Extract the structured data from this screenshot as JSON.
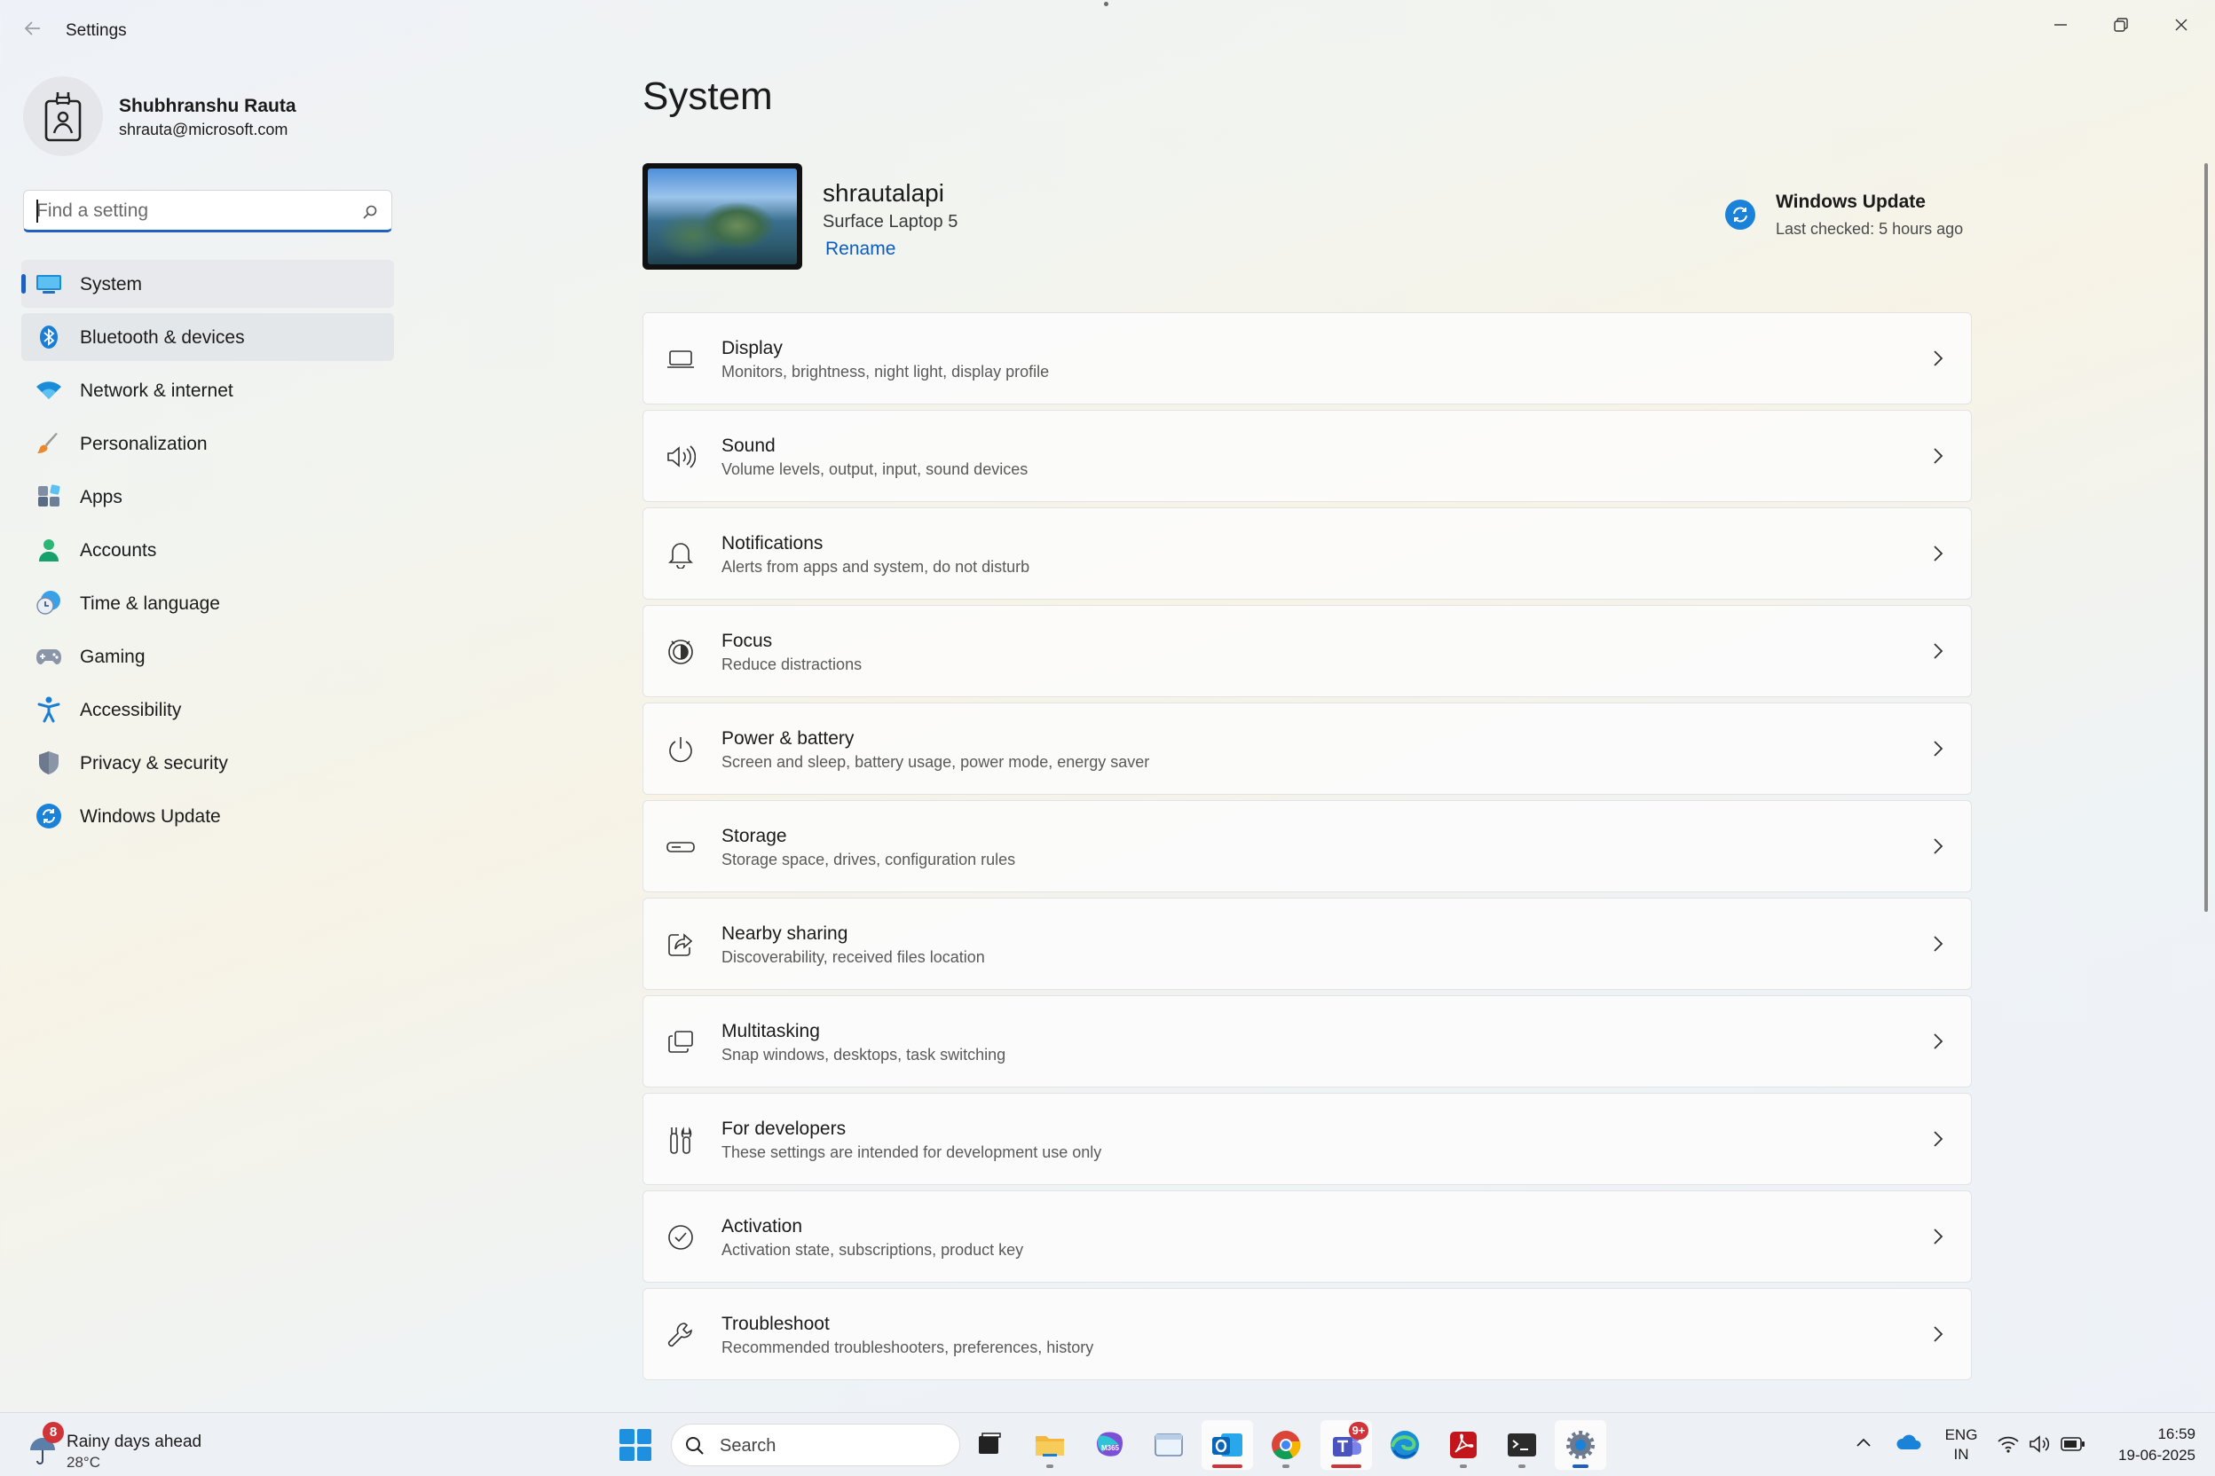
{
  "window": {
    "title": "Settings",
    "back_icon": "back-arrow-icon"
  },
  "profile": {
    "name": "Shubhranshu Rauta",
    "email": "shrauta@microsoft.com"
  },
  "search": {
    "placeholder": "Find a setting",
    "value": ""
  },
  "sidebar": {
    "items": [
      {
        "label": "System",
        "icon": "system-icon",
        "active": true
      },
      {
        "label": "Bluetooth & devices",
        "icon": "bluetooth-icon"
      },
      {
        "label": "Network & internet",
        "icon": "wifi-icon"
      },
      {
        "label": "Personalization",
        "icon": "brush-icon"
      },
      {
        "label": "Apps",
        "icon": "apps-icon"
      },
      {
        "label": "Accounts",
        "icon": "account-icon"
      },
      {
        "label": "Time & language",
        "icon": "globe-clock-icon"
      },
      {
        "label": "Gaming",
        "icon": "gamepad-icon"
      },
      {
        "label": "Accessibility",
        "icon": "accessibility-icon"
      },
      {
        "label": "Privacy & security",
        "icon": "shield-icon"
      },
      {
        "label": "Windows Update",
        "icon": "update-icon"
      }
    ]
  },
  "main": {
    "title": "System",
    "device": {
      "name": "shrautalapi",
      "model": "Surface Laptop 5",
      "rename_label": "Rename"
    },
    "windows_update": {
      "title": "Windows Update",
      "subtitle": "Last checked: 5 hours ago"
    },
    "cards": [
      {
        "title": "Display",
        "subtitle": "Monitors, brightness, night light, display profile",
        "icon": "display-icon"
      },
      {
        "title": "Sound",
        "subtitle": "Volume levels, output, input, sound devices",
        "icon": "speaker-icon"
      },
      {
        "title": "Notifications",
        "subtitle": "Alerts from apps and system, do not disturb",
        "icon": "bell-icon"
      },
      {
        "title": "Focus",
        "subtitle": "Reduce distractions",
        "icon": "focus-icon"
      },
      {
        "title": "Power & battery",
        "subtitle": "Screen and sleep, battery usage, power mode, energy saver",
        "icon": "power-icon"
      },
      {
        "title": "Storage",
        "subtitle": "Storage space, drives, configuration rules",
        "icon": "storage-icon"
      },
      {
        "title": "Nearby sharing",
        "subtitle": "Discoverability, received files location",
        "icon": "share-icon"
      },
      {
        "title": "Multitasking",
        "subtitle": "Snap windows, desktops, task switching",
        "icon": "multitask-icon"
      },
      {
        "title": "For developers",
        "subtitle": "These settings are intended for development use only",
        "icon": "developer-tools-icon"
      },
      {
        "title": "Activation",
        "subtitle": "Activation state, subscriptions, product key",
        "icon": "checkmark-circle-icon"
      },
      {
        "title": "Troubleshoot",
        "subtitle": "Recommended troubleshooters, preferences, history",
        "icon": "wrench-icon"
      }
    ]
  },
  "taskbar": {
    "weather": {
      "badge": "8",
      "title": "Rainy days ahead",
      "temp": "28°C"
    },
    "search_label": "Search",
    "apps": [
      {
        "name": "task-view-app",
        "badge": ""
      },
      {
        "name": "file-explorer-app",
        "badge": ""
      },
      {
        "name": "m365-app",
        "badge": ""
      },
      {
        "name": "window-app",
        "badge": ""
      },
      {
        "name": "outlook-app",
        "badge": ""
      },
      {
        "name": "chrome-app",
        "badge": ""
      },
      {
        "name": "teams-app",
        "badge": "9+"
      },
      {
        "name": "edge-app",
        "badge": ""
      },
      {
        "name": "acrobat-app",
        "badge": ""
      },
      {
        "name": "terminal-app",
        "badge": ""
      },
      {
        "name": "settings-app",
        "badge": ""
      }
    ],
    "lang_line1": "ENG",
    "lang_line2": "IN",
    "time": "16:59",
    "date": "19-06-2025"
  }
}
